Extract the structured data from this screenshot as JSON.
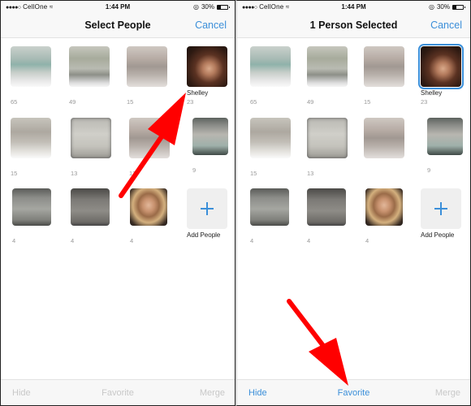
{
  "screens": [
    {
      "status": {
        "signal_dots": "●●●●○",
        "carrier": "CellOne",
        "wifi_icon": "wifi-icon",
        "time": "1:44 PM",
        "orientation_lock_icon": "orientation-lock-icon",
        "battery_percent": "30%",
        "battery_level": 0.3
      },
      "nav": {
        "title": "Select People",
        "cancel_label": "Cancel"
      },
      "people": [
        {
          "name": "",
          "count": "65",
          "selected": false
        },
        {
          "name": "",
          "count": "49",
          "selected": false
        },
        {
          "name": "",
          "count": "15",
          "selected": false
        },
        {
          "name": "Shelley",
          "count": "23",
          "selected": false
        },
        {
          "name": "",
          "count": "15",
          "selected": false
        },
        {
          "name": "",
          "count": "13",
          "selected": false
        },
        {
          "name": "",
          "count": "12",
          "selected": false
        },
        {
          "name": "",
          "count": "9",
          "selected": false
        },
        {
          "name": "",
          "count": "4",
          "selected": false
        },
        {
          "name": "",
          "count": "4",
          "selected": false
        },
        {
          "name": "",
          "count": "4",
          "selected": false
        }
      ],
      "add_people_label": "Add People",
      "toolbar": {
        "hide_label": "Hide",
        "hide_enabled": false,
        "favorite_label": "Favorite",
        "favorite_enabled": false,
        "merge_label": "Merge",
        "merge_enabled": false
      }
    },
    {
      "status": {
        "signal_dots": "●●●●○",
        "carrier": "CellOne",
        "wifi_icon": "wifi-icon",
        "time": "1:44 PM",
        "orientation_lock_icon": "orientation-lock-icon",
        "battery_percent": "30%",
        "battery_level": 0.3
      },
      "nav": {
        "title": "1 Person Selected",
        "cancel_label": "Cancel"
      },
      "people": [
        {
          "name": "",
          "count": "65",
          "selected": false
        },
        {
          "name": "",
          "count": "49",
          "selected": false
        },
        {
          "name": "",
          "count": "15",
          "selected": false
        },
        {
          "name": "Shelley",
          "count": "23",
          "selected": true
        },
        {
          "name": "",
          "count": "15",
          "selected": false
        },
        {
          "name": "",
          "count": "13",
          "selected": false
        },
        {
          "name": "",
          "count": "",
          "selected": false
        },
        {
          "name": "",
          "count": "9",
          "selected": false
        },
        {
          "name": "",
          "count": "4",
          "selected": false
        },
        {
          "name": "",
          "count": "4",
          "selected": false
        },
        {
          "name": "",
          "count": "4",
          "selected": false
        }
      ],
      "add_people_label": "Add People",
      "toolbar": {
        "hide_label": "Hide",
        "hide_enabled": true,
        "favorite_label": "Favorite",
        "favorite_enabled": true,
        "merge_label": "Merge",
        "merge_enabled": false
      }
    }
  ],
  "annotations": {
    "arrow_color": "#ff0000",
    "accent_color": "#3b8fd9"
  }
}
